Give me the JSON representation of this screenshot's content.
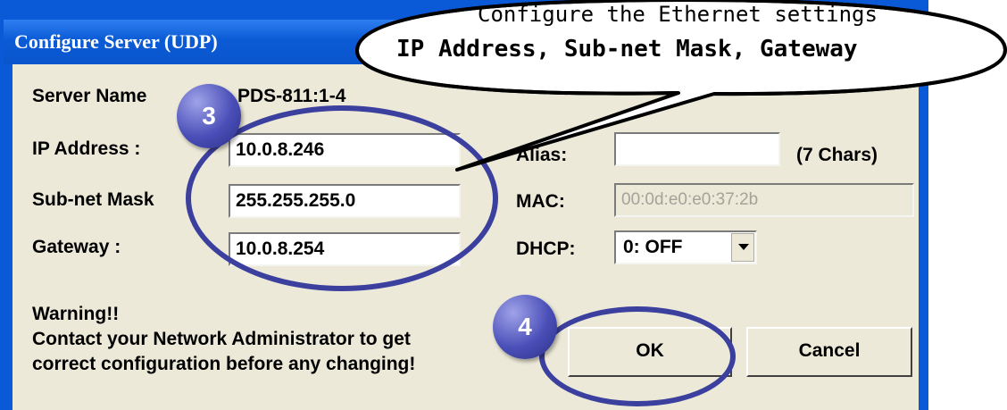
{
  "window": {
    "title": "Configure Server (UDP)"
  },
  "callout": {
    "line1": "Configure the Ethernet settings",
    "line2": "IP Address, Sub-net Mask, Gateway"
  },
  "steps": {
    "step3": "3",
    "step4": "4"
  },
  "fields": {
    "server_name_label": "Server Name",
    "server_name_value": "PDS-811:1-4",
    "ip_label": "IP Address :",
    "ip_value": "10.0.8.246",
    "mask_label": "Sub-net Mask",
    "mask_value": "255.255.255.0",
    "gateway_label": "Gateway :",
    "gateway_value": "10.0.8.254",
    "alias_label": "Alias:",
    "alias_value": "",
    "alias_hint": "(7 Chars)",
    "mac_label": "MAC:",
    "mac_value": "00:0d:e0:e0:37:2b",
    "dhcp_label": "DHCP:",
    "dhcp_value": "0: OFF"
  },
  "warning": {
    "line1": "Warning!!",
    "line2": "Contact your Network Administrator to get",
    "line3": "correct  configuration before any changing!"
  },
  "buttons": {
    "ok": "OK",
    "cancel": "Cancel"
  },
  "colors": {
    "title_bar": "#0b5bd6",
    "client_bg": "#ece9d8",
    "annotation": "#3b3f9e"
  }
}
